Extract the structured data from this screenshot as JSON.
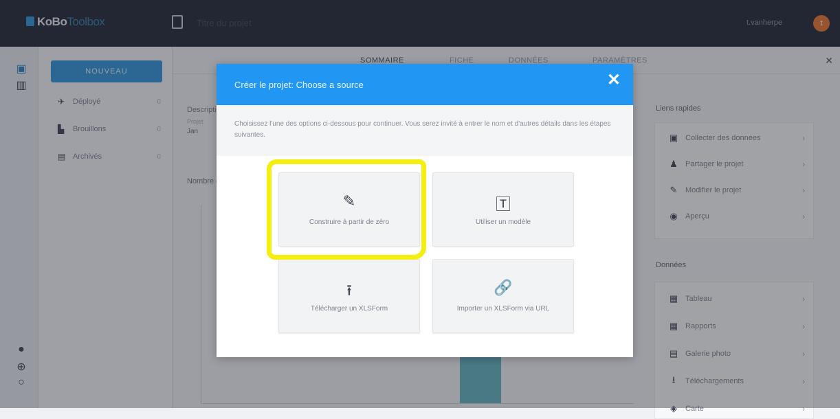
{
  "topbar": {
    "logo_text": "KoBo",
    "logo_suffix": "Toolbox",
    "project_title": "Titre du projet",
    "username": "t.vanherpe",
    "avatar_letter": "t",
    "icons": {
      "logo": "logo-icon",
      "project": "document-icon"
    }
  },
  "rail": {
    "icons": [
      "forms-icon",
      "library-icon",
      "help-icon",
      "language-icon",
      "github-icon"
    ]
  },
  "sidebar": {
    "new_button": "NOUVEAU",
    "items": [
      {
        "label": "Déployé",
        "count": "0",
        "icon": "rocket-icon"
      },
      {
        "label": "Brouillons",
        "count": "0",
        "icon": "drafts-icon"
      },
      {
        "label": "Archivés",
        "count": "0",
        "icon": "archive-icon"
      }
    ]
  },
  "main": {
    "tabs": [
      {
        "label": "SOMMAIRE",
        "active": true
      },
      {
        "label": "FICHE",
        "active": false
      },
      {
        "label": "DONNÉES",
        "active": false
      },
      {
        "label": "PARAMÈTRES",
        "active": false
      }
    ],
    "description_label": "Description",
    "description_sub": "Projet",
    "description_value": "Jan",
    "stats_label": "Nombre de soumissions",
    "right": {
      "quick_links_title": "Liens rapides",
      "quick_links": [
        {
          "label": "Collecter des données",
          "icon": "collect-icon"
        },
        {
          "label": "Partager le projet",
          "icon": "share-user-icon"
        },
        {
          "label": "Modifier le projet",
          "icon": "pencil-icon"
        },
        {
          "label": "Aperçu",
          "icon": "eye-icon"
        }
      ],
      "data_title": "Données",
      "data_links": [
        {
          "label": "Tableau",
          "icon": "table-icon"
        },
        {
          "label": "Rapports",
          "icon": "reports-icon"
        },
        {
          "label": "Galerie photo",
          "icon": "gallery-icon"
        },
        {
          "label": "Téléchargements",
          "icon": "download-icon"
        },
        {
          "label": "Carte",
          "icon": "map-icon"
        }
      ]
    }
  },
  "modal": {
    "title": "Créer le projet: Choose a source",
    "close": "✕",
    "info": "Choisissez l'une des options ci-dessous pour continuer. Vous serez invité à entrer le nom et d'autres détails dans les étapes suivantes.",
    "options": [
      {
        "label": "Construire à partir de zéro",
        "icon": "pencil-icon",
        "glyph": "✎"
      },
      {
        "label": "Utiliser un modèle",
        "icon": "template-icon",
        "glyph": "🅃"
      },
      {
        "label": "Télécharger un XLSForm",
        "icon": "upload-icon",
        "glyph": "⭱"
      },
      {
        "label": "Importer un XLSForm via URL",
        "icon": "link-icon",
        "glyph": "🔗"
      }
    ]
  },
  "colors": {
    "header": "#1f2532",
    "modal_header": "#2196f3",
    "highlight": "#f4ee11",
    "chart_bar": "#5fb2bf"
  }
}
